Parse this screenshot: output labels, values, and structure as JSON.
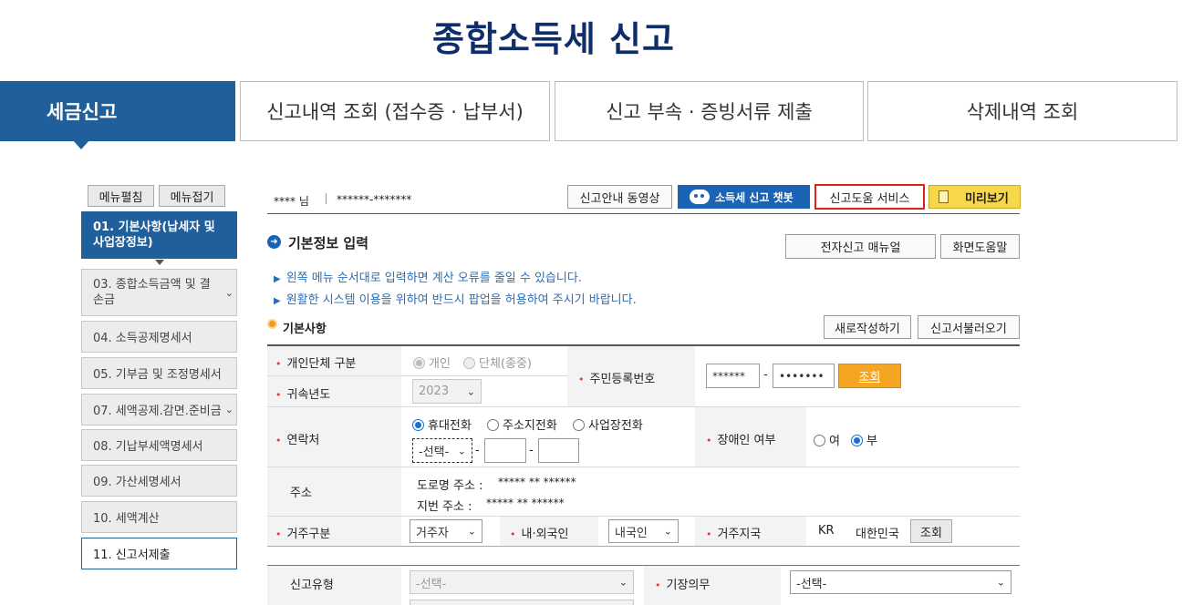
{
  "page_title": "종합소득세  신고",
  "tabs": [
    {
      "label": "세금신고"
    },
    {
      "label": "신고내역 조회 (접수증 · 납부서)"
    },
    {
      "label": "신고 부속 · 증빙서류 제출"
    },
    {
      "label": "삭제내역 조회"
    }
  ],
  "sidebar": {
    "expand_label": "메뉴펼침",
    "collapse_label": "메뉴접기",
    "items": [
      {
        "label": "01. 기본사항(납세자 및 사업장정보)"
      },
      {
        "label": "03. 종합소득금액 및 결손금"
      },
      {
        "label": "04. 소득공제명세서"
      },
      {
        "label": "05. 기부금 및 조정명세서"
      },
      {
        "label": "07. 세액공제.감면.준비금"
      },
      {
        "label": "08. 기납부세액명세서"
      },
      {
        "label": "09. 가산세명세서"
      },
      {
        "label": "10. 세액계산"
      },
      {
        "label": "11. 신고서제출"
      }
    ]
  },
  "user": {
    "name": "**** 님",
    "id": "******-*******"
  },
  "toolbar": {
    "video_label": "신고안내 동영상",
    "chatbot_label": "소득세 신고 챗봇",
    "help_service_label": "신고도움 서비스",
    "preview_label": "미리보기"
  },
  "section": {
    "title": "기본정보 입력",
    "manual_label": "전자신고 매뉴얼",
    "screen_help_label": "화면도움말",
    "notices": [
      "왼쪽 메뉴 순서대로 입력하면 계산 오류를 줄일 수 있습니다.",
      "원활한 시스템 이용을 위하여 반드시 팝업을 허용하여 주시기 바랍니다."
    ],
    "basic_title": "기본사항",
    "new_write_label": "새로작성하기",
    "load_label": "신고서불러오기"
  },
  "form": {
    "entity_type_label": "개인단체 구분",
    "entity_individual": "개인",
    "entity_group": "단체(종중)",
    "year_label": "귀속년도",
    "year_value": "2023",
    "rrn_label": "주민등록번호",
    "rrn_front": "******",
    "rrn_dash": "-",
    "rrn_back": "•••••••",
    "lookup_label": "조회",
    "contact_label": "연락처",
    "contact_mobile": "휴대전화",
    "contact_home": "주소지전화",
    "contact_work": "사업장전화",
    "contact_select": "-선택-",
    "disabled_label": "장애인 여부",
    "disabled_yes": "여",
    "disabled_no": "부",
    "address_label": "주소",
    "road_address_label": "도로명 주소 :",
    "road_address_value": "*****  **  ******",
    "lot_address_label": "지번 주소 :",
    "lot_address_value": "*****  **  ******",
    "residence_label": "거주구분",
    "residence_value": "거주자",
    "nationality_label": "내·외국인",
    "nationality_value": "내국인",
    "country_label": "거주지국",
    "country_code": "KR",
    "country_name": "대한민국",
    "country_lookup": "조회",
    "report_type_label": "신고유형",
    "report_type_value": "-선택-",
    "bookkeeping_label": "기장의무",
    "bookkeeping_value": "-선택-"
  }
}
